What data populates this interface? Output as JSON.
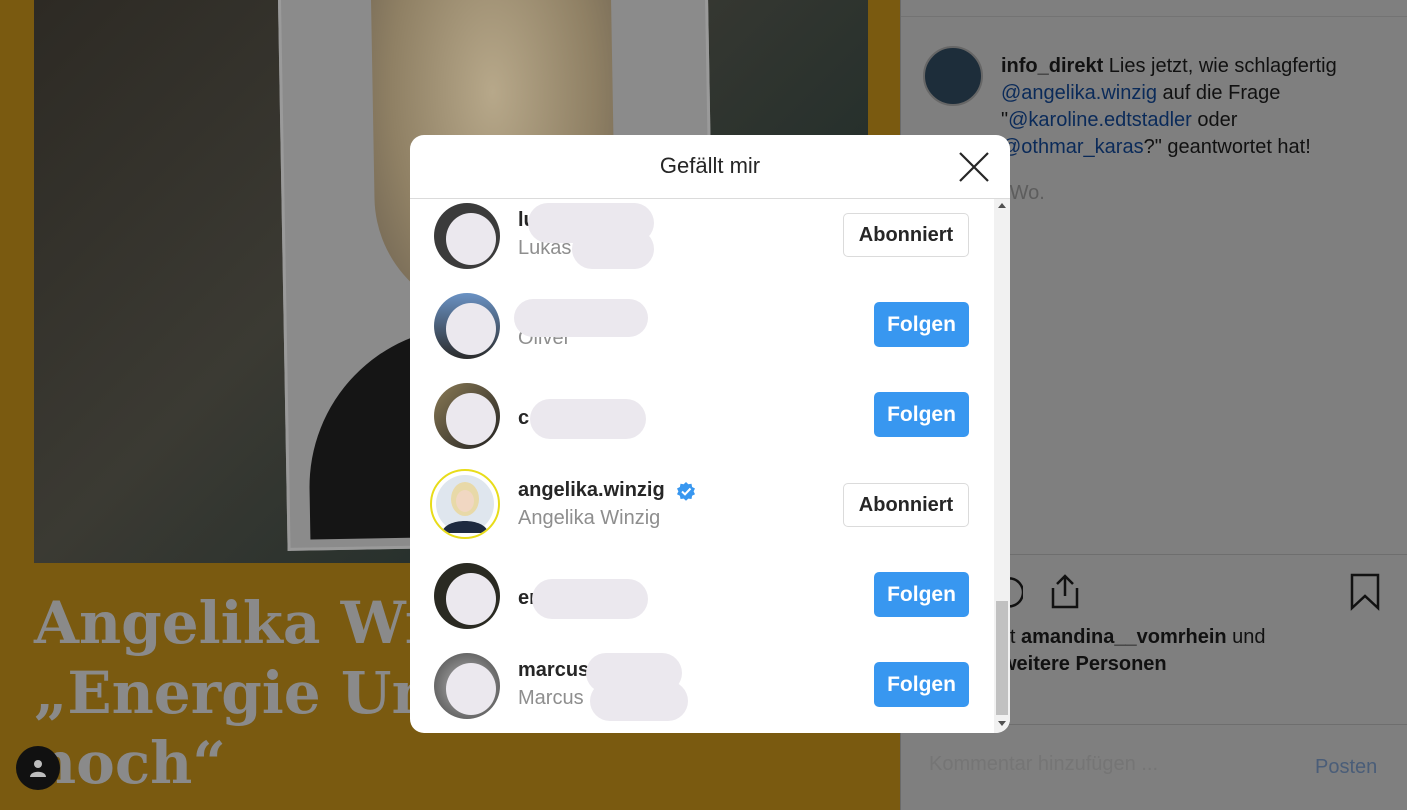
{
  "post": {
    "headline_lines": [
      "Angelika Winz",
      "„Energie Unio",
      "noch“"
    ],
    "author": "info_direkt",
    "caption_text_1": " Lies jetzt, wie schlagfertig",
    "caption_mention_1": "@angelika.winzig",
    "caption_text_2": " auf die Frage",
    "caption_quote_open": "\"",
    "caption_mention_2": "@karoline.edtstadler",
    "caption_text_3": " oder",
    "caption_mention_3": "@othmar_karas",
    "caption_text_4": "?\" geantwortet hat!",
    "time_ago": "-Wo.",
    "liked_by_prefix": "llt ",
    "liked_by_user": "amandina__vomrhein",
    "liked_by_suffix": " und",
    "liked_by_others": "weitere Personen",
    "comment_placeholder": "Kommentar hinzufügen ...",
    "post_button": "Posten",
    "icons": [
      "comment-icon",
      "share-icon",
      "bookmark-icon",
      "user-icon"
    ]
  },
  "modal": {
    "title": "Gefällt mir",
    "close_icon": "close-icon",
    "users": [
      {
        "username": "lu",
        "fullname": "Lukas",
        "button": "Abonniert",
        "following": true,
        "verified": false
      },
      {
        "username": "",
        "fullname": "Oliver",
        "button": "Folgen",
        "following": false,
        "verified": false
      },
      {
        "username": "c",
        "fullname": "",
        "button": "Folgen",
        "following": false,
        "verified": false
      },
      {
        "username": "angelika.winzig",
        "fullname": "Angelika Winzig",
        "button": "Abonniert",
        "following": true,
        "verified": true
      },
      {
        "username": "er",
        "fullname": "",
        "button": "Folgen",
        "following": false,
        "verified": false
      },
      {
        "username": "marcus",
        "fullname": "Marcus",
        "button": "Folgen",
        "following": false,
        "verified": false
      }
    ]
  },
  "colors": {
    "follow_blue": "#3897f0",
    "verified_blue": "#3897f0",
    "secondary_text": "#8e8e8e",
    "post_yellow": "#f2b01e"
  }
}
